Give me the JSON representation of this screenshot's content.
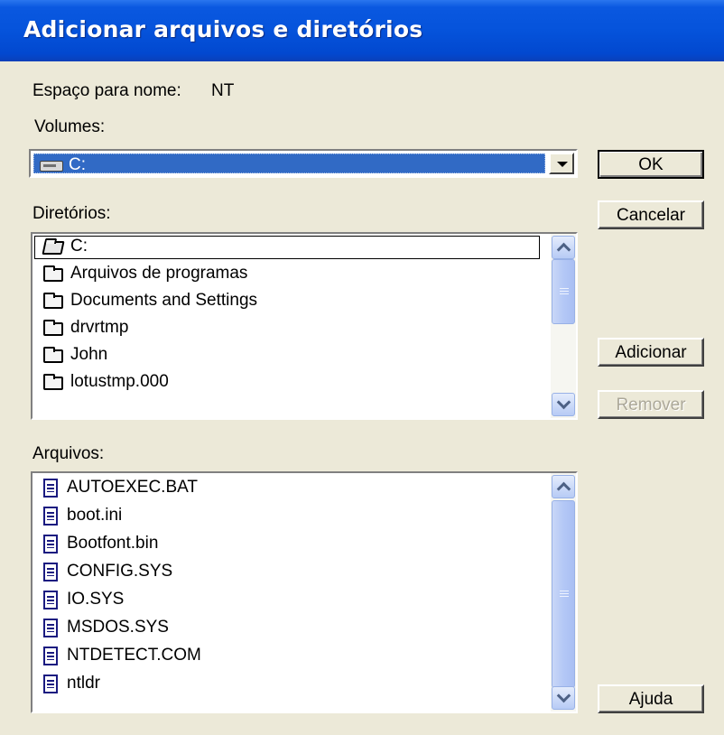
{
  "window": {
    "title": "Adicionar arquivos e diretórios"
  },
  "namespace": {
    "label": "Espaço para nome:",
    "value": "NT"
  },
  "volumes": {
    "label": "Volumes:",
    "selected": "C:",
    "icon": "drive-icon"
  },
  "directories": {
    "label": "Diretórios:",
    "items": [
      {
        "name": "C:",
        "icon": "open-folder-icon"
      },
      {
        "name": "Arquivos de programas",
        "icon": "folder-icon"
      },
      {
        "name": "Documents and Settings",
        "icon": "folder-icon"
      },
      {
        "name": "drvrtmp",
        "icon": "folder-icon"
      },
      {
        "name": "John",
        "icon": "folder-icon"
      },
      {
        "name": "lotustmp.000",
        "icon": "folder-icon"
      }
    ]
  },
  "files": {
    "label": "Arquivos:",
    "items": [
      {
        "name": "AUTOEXEC.BAT",
        "icon": "document-icon"
      },
      {
        "name": "boot.ini",
        "icon": "document-icon"
      },
      {
        "name": "Bootfont.bin",
        "icon": "document-icon"
      },
      {
        "name": "CONFIG.SYS",
        "icon": "document-icon"
      },
      {
        "name": "IO.SYS",
        "icon": "document-icon"
      },
      {
        "name": "MSDOS.SYS",
        "icon": "document-icon"
      },
      {
        "name": "NTDETECT.COM",
        "icon": "document-icon"
      },
      {
        "name": "ntldr",
        "icon": "document-icon"
      }
    ]
  },
  "buttons": {
    "ok": "OK",
    "cancel": "Cancelar",
    "add": "Adicionar",
    "remove": "Remover",
    "help": "Ajuda"
  }
}
